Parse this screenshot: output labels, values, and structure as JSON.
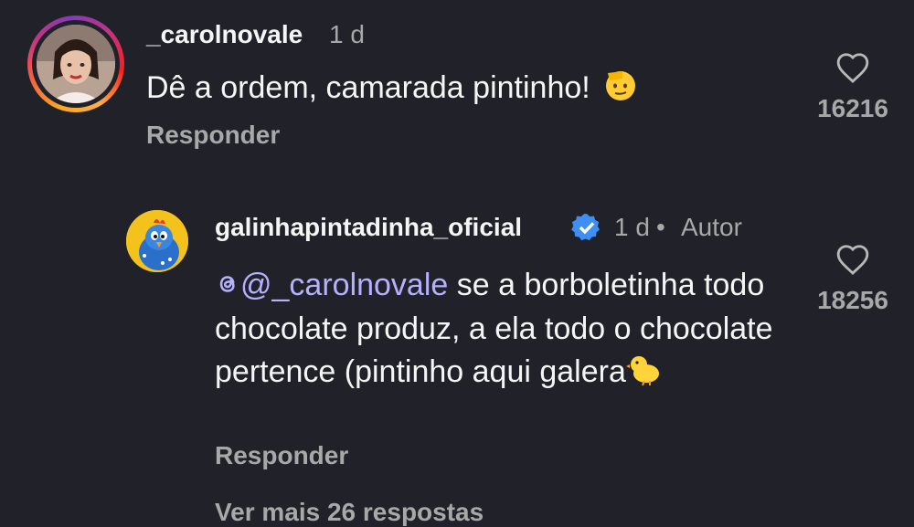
{
  "comments": [
    {
      "username": "_carolnovale",
      "time": "1 d",
      "text": "Dê a ordem, camarada pintinho!",
      "emoji": "🫡",
      "reply_label": "Responder",
      "likes": "16216"
    }
  ],
  "reply_comment": {
    "username": "galinhapintadinha_oficial",
    "time": "1 d",
    "separator": "•",
    "author_tag": "Autor",
    "mention": "@_carolnovale",
    "text": " se a borboletinha todo chocolate produz, a ela todo o chocolate pertence (pintinho aqui galera",
    "emoji": "🐤",
    "reply_label": "Responder",
    "likes": "18256"
  },
  "more_replies": "Ver mais 26 respostas",
  "colors": {
    "background": "#212229",
    "primary_text": "#f5f5f5",
    "secondary_text": "#a8a8a8",
    "verified": "#3d8ff5",
    "mention": "#b5b0ff"
  },
  "icons": [
    "heart-icon",
    "verified-badge-icon",
    "threads-icon"
  ]
}
